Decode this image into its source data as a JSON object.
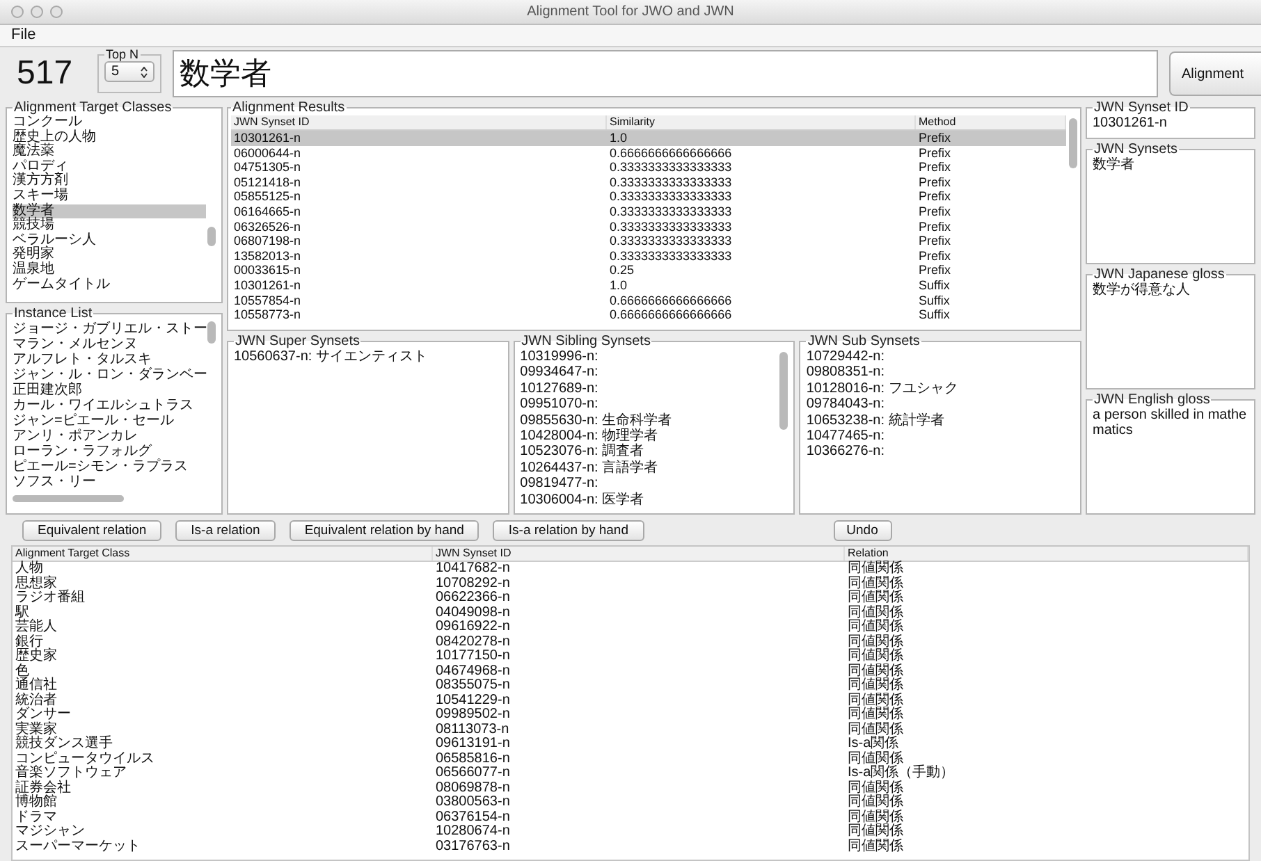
{
  "window": {
    "title": "Alignment Tool for JWO and JWN"
  },
  "menu": [
    "File"
  ],
  "count": "517",
  "top_n": {
    "label": "Top N",
    "value": "5"
  },
  "query": {
    "value": "数学者"
  },
  "alignment_button": "Alignment",
  "target_classes": {
    "title": "Alignment Target Classes",
    "items": [
      {
        "label": "コンクール",
        "selected": false
      },
      {
        "label": "歴史上の人物",
        "selected": false
      },
      {
        "label": "魔法薬",
        "selected": false
      },
      {
        "label": "パロディ",
        "selected": false
      },
      {
        "label": "漢方方剤",
        "selected": false
      },
      {
        "label": "スキー場",
        "selected": false
      },
      {
        "label": "数学者",
        "selected": true
      },
      {
        "label": "競技場",
        "selected": false
      },
      {
        "label": "ベラルーシ人",
        "selected": false
      },
      {
        "label": "発明家",
        "selected": false
      },
      {
        "label": "温泉地",
        "selected": false
      },
      {
        "label": "ゲームタイトル",
        "selected": false
      }
    ]
  },
  "instance_list": {
    "title": "Instance List",
    "items": [
      "ジョージ・ガブリエル・ストー",
      "マラン・メルセンヌ",
      "アルフレト・タルスキ",
      "ジャン・ル・ロン・ダランベー",
      "正田建次郎",
      "カール・ワイエルシュトラス",
      "ジャン=ピエール・セール",
      "アンリ・ポアンカレ",
      "ローラン・ラフォルグ",
      "ピエール=シモン・ラプラス",
      "ソフス・リー"
    ]
  },
  "results": {
    "title": "Alignment Results",
    "columns": [
      "JWN Synset ID",
      "Similarity",
      "Method"
    ],
    "rows": [
      {
        "cells": [
          "10301261-n",
          "1.0",
          "Prefix"
        ],
        "selected": true
      },
      {
        "cells": [
          "06000644-n",
          "0.6666666666666666",
          "Prefix"
        ],
        "selected": false
      },
      {
        "cells": [
          "04751305-n",
          "0.3333333333333333",
          "Prefix"
        ],
        "selected": false
      },
      {
        "cells": [
          "05121418-n",
          "0.3333333333333333",
          "Prefix"
        ],
        "selected": false
      },
      {
        "cells": [
          "05855125-n",
          "0.3333333333333333",
          "Prefix"
        ],
        "selected": false
      },
      {
        "cells": [
          "06164665-n",
          "0.3333333333333333",
          "Prefix"
        ],
        "selected": false
      },
      {
        "cells": [
          "06326526-n",
          "0.3333333333333333",
          "Prefix"
        ],
        "selected": false
      },
      {
        "cells": [
          "06807198-n",
          "0.3333333333333333",
          "Prefix"
        ],
        "selected": false
      },
      {
        "cells": [
          "13582013-n",
          "0.3333333333333333",
          "Prefix"
        ],
        "selected": false
      },
      {
        "cells": [
          "00033615-n",
          "0.25",
          "Prefix"
        ],
        "selected": false
      },
      {
        "cells": [
          "10301261-n",
          "1.0",
          "Suffix"
        ],
        "selected": false
      },
      {
        "cells": [
          "10557854-n",
          "0.6666666666666666",
          "Suffix"
        ],
        "selected": false
      },
      {
        "cells": [
          "10558773-n",
          "0.6666666666666666",
          "Suffix"
        ],
        "selected": false
      }
    ]
  },
  "synset_panels": [
    {
      "title": "JWN Super Synsets",
      "scrollbar": false,
      "items": [
        "10560637-n: サイエンティスト"
      ]
    },
    {
      "title": "JWN Sibling Synsets",
      "scrollbar": true,
      "items": [
        "10319996-n:",
        "09934647-n:",
        "10127689-n:",
        "09951070-n:",
        "09855630-n: 生命科学者",
        "10428004-n: 物理学者",
        "10523076-n: 調査者",
        "10264437-n: 言語学者",
        "09819477-n:",
        "10306004-n: 医学者"
      ]
    },
    {
      "title": "JWN Sub Synsets",
      "scrollbar": false,
      "items": [
        "10729442-n:",
        "09808351-n:",
        "10128016-n: フユシャク",
        "09784043-n:",
        "10653238-n: 統計学者",
        "10477465-n:",
        "10366276-n:"
      ]
    }
  ],
  "synset_id": {
    "title": "JWN Synset ID",
    "value": "10301261-n"
  },
  "detail_panels": [
    {
      "title": "JWN Synsets",
      "text": "数学者"
    },
    {
      "title": "JWN Japanese gloss",
      "text": "数学が得意な人"
    },
    {
      "title": "JWN English gloss",
      "text": "a person skilled in mathematics"
    }
  ],
  "buttons": [
    "Equivalent relation",
    "Is-a relation",
    "Equivalent relation by hand",
    "Is-a relation by hand"
  ],
  "undo_button": "Undo",
  "alignments": {
    "columns": [
      "Alignment Target Class",
      "JWN Synset ID",
      "Relation"
    ],
    "rows": [
      [
        "人物",
        "10417682-n",
        "同値関係"
      ],
      [
        "思想家",
        "10708292-n",
        "同値関係"
      ],
      [
        "ラジオ番組",
        "06622366-n",
        "同値関係"
      ],
      [
        "駅",
        "04049098-n",
        "同値関係"
      ],
      [
        "芸能人",
        "09616922-n",
        "同値関係"
      ],
      [
        "銀行",
        "08420278-n",
        "同値関係"
      ],
      [
        "歴史家",
        "10177150-n",
        "同値関係"
      ],
      [
        "色",
        "04674968-n",
        "同値関係"
      ],
      [
        "通信社",
        "08355075-n",
        "同値関係"
      ],
      [
        "統治者",
        "10541229-n",
        "同値関係"
      ],
      [
        "ダンサー",
        "09989502-n",
        "同値関係"
      ],
      [
        "実業家",
        "08113073-n",
        "同値関係"
      ],
      [
        "競技ダンス選手",
        "09613191-n",
        "Is-a関係"
      ],
      [
        "コンピュータウイルス",
        "06585816-n",
        "同値関係"
      ],
      [
        "音楽ソフトウェア",
        "06566077-n",
        "Is-a関係（手動）"
      ],
      [
        "証券会社",
        "08069878-n",
        "同値関係"
      ],
      [
        "博物館",
        "03800563-n",
        "同値関係"
      ],
      [
        "ドラマ",
        "06376154-n",
        "同値関係"
      ],
      [
        "マジシャン",
        "10280674-n",
        "同値関係"
      ],
      [
        "スーパーマーケット",
        "03176763-n",
        "同値関係"
      ]
    ]
  }
}
